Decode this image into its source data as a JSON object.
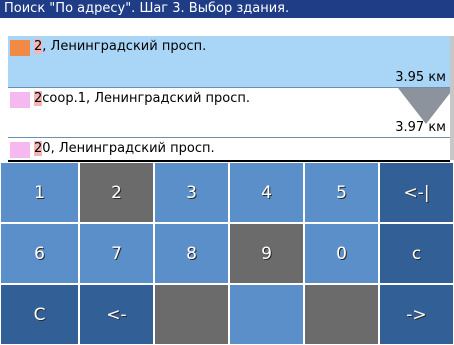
{
  "window": {
    "title": "Поиск \"По адресу\". Шаг 3. Выбор здания."
  },
  "results": [
    {
      "number": "2",
      "address": ", Ленинградский просп.",
      "distance": "3.95 км",
      "swatch": "#f08a45"
    },
    {
      "number": "2",
      "address": "соор.1, Ленинградский просп.",
      "distance": "3.97 км",
      "swatch": "#f5b8ef"
    },
    {
      "number": "2",
      "number_rest": "0",
      "address": ", Ленинградский просп.",
      "distance": "",
      "swatch": "#f5b8ef"
    }
  ],
  "keypad": {
    "rows": [
      [
        "1",
        "2",
        "3",
        "4",
        "5",
        "<-|"
      ],
      [
        "6",
        "7",
        "8",
        "9",
        "0",
        "c"
      ],
      [
        "C",
        "<-",
        "",
        "",
        "",
        "->"
      ]
    ]
  },
  "colors": {
    "title_bar": "#1f3c86",
    "selected_row": "#a9d6f7",
    "key_active": "#5b8fc9",
    "key_disabled": "#6b6b6b",
    "key_function": "#325f95"
  },
  "icons": {
    "scroll_down": "down-triangle-icon"
  }
}
